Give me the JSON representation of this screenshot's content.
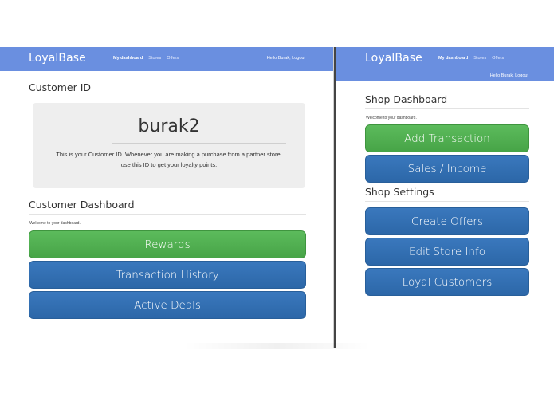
{
  "customer_screen": {
    "brand": "LoyalBase",
    "nav": [
      "My dashboard",
      "Stores",
      "Offers"
    ],
    "user_nav": "Hello Burak, Logout",
    "customer_id_title": "Customer ID",
    "customer_id_value": "burak2",
    "customer_id_text_line1": "This is your Customer ID. Whenever you are making a purchase from a partner store,",
    "customer_id_text_line2": "use this ID to get your loyalty points.",
    "dashboard_title": "Customer Dashboard",
    "welcome": "Welcome to your dashboard.",
    "buttons": [
      "Rewards",
      "Transaction History",
      "Active Deals"
    ]
  },
  "shop_screen": {
    "brand": "LoyalBase",
    "nav": [
      "My dashboard",
      "Stores",
      "Offers"
    ],
    "user_nav": "Hello Burak, Logout",
    "dashboard_title": "Shop Dashboard",
    "welcome": "Welcome to your dashboard.",
    "dashboard_buttons": [
      "Add Transaction",
      "Sales / Income"
    ],
    "settings_title": "Shop Settings",
    "settings_buttons": [
      "Create Offers",
      "Edit Store Info",
      "Loyal Customers"
    ]
  },
  "colors": {
    "navbar": "#6a8fe0",
    "button_green": "#4cae4c",
    "button_blue": "#2f6eb2",
    "well": "#eeeeee"
  }
}
